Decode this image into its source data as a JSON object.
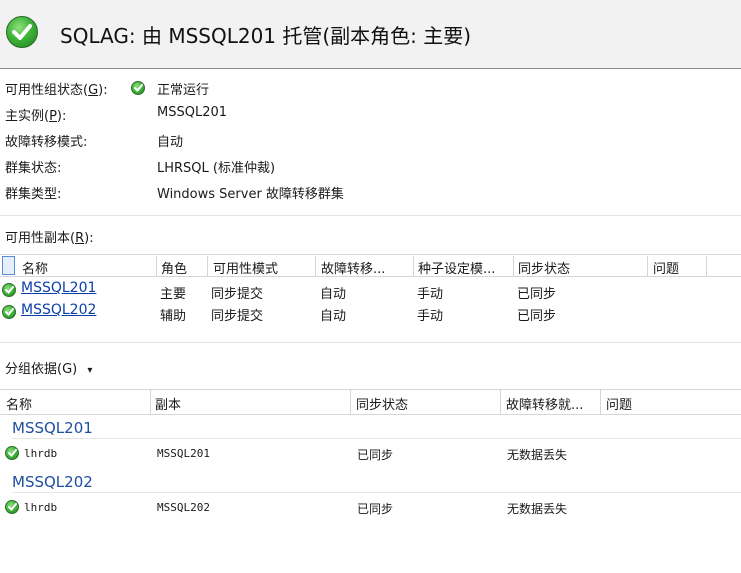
{
  "header": {
    "title": "SQLAG: 由 MSSQL201 托管(副本角色: 主要)"
  },
  "properties": [
    {
      "label_pre": "可用性组状态(",
      "label_key": "G",
      "label_post": "):",
      "value": "正常运行",
      "has_icon": true
    },
    {
      "label_pre": "主实例(",
      "label_key": "P",
      "label_post": "):",
      "value": "MSSQL201"
    },
    {
      "label": "故障转移模式:",
      "value": "自动"
    },
    {
      "label": "群集状态:",
      "value": "LHRSQL (标准仲裁)"
    },
    {
      "label": "群集类型:",
      "value": "Windows Server 故障转移群集"
    }
  ],
  "replicas": {
    "title_pre": "可用性副本(",
    "title_key": "R",
    "title_post": "):",
    "columns": [
      "名称",
      "角色",
      "可用性模式",
      "故障转移...",
      "种子设定模...",
      "同步状态",
      "问题"
    ],
    "rows": [
      {
        "name": "MSSQL201",
        "role": "主要",
        "availability": "同步提交",
        "failover": "自动",
        "seeding": "手动",
        "sync": "已同步",
        "issues": ""
      },
      {
        "name": "MSSQL202",
        "role": "辅助",
        "availability": "同步提交",
        "failover": "自动",
        "seeding": "手动",
        "sync": "已同步",
        "issues": ""
      }
    ]
  },
  "grouping": {
    "label": "分组依据(G)",
    "arrow": "▾"
  },
  "databases": {
    "columns": [
      "名称",
      "副本",
      "同步状态",
      "故障转移就...",
      "问题"
    ],
    "groups": [
      {
        "group": "MSSQL201",
        "db": "lhrdb",
        "replica": "MSSQL201",
        "sync": "已同步",
        "failover": "无数据丢失",
        "issues": ""
      },
      {
        "group": "MSSQL202",
        "db": "lhrdb",
        "replica": "MSSQL202",
        "sync": "已同步",
        "failover": "无数据丢失",
        "issues": ""
      }
    ]
  },
  "colors": {
    "link": "#0b3fa8",
    "group_header": "#1f4fa0",
    "ok_green": "#3fb43a",
    "header_bg": "#f2f2f2"
  },
  "icons": {
    "status_ok": "check-circle-icon"
  }
}
